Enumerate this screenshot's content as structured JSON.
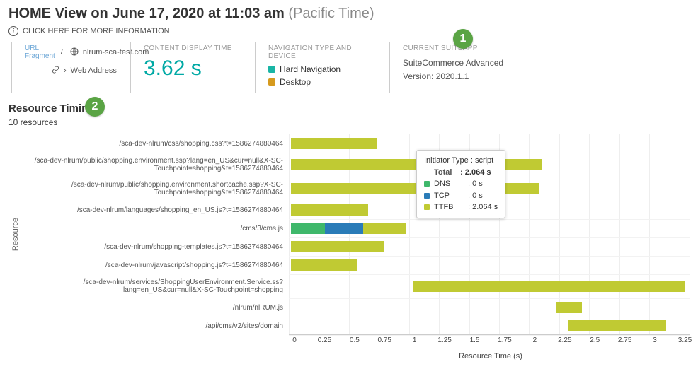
{
  "header": {
    "title_prefix": "HOME View on ",
    "date": "June 17, 2020",
    "at": " at ",
    "time": "11:03 am",
    "tz": " (Pacific Time)",
    "info_link": "CLICK HERE FOR MORE INFORMATION"
  },
  "badges": {
    "one": "1",
    "two": "2"
  },
  "url_panel": {
    "frag_label": "URL\nFragment",
    "domain": "nlrum-sca-test.com",
    "slash": "/",
    "web_address": "Web Address"
  },
  "cdt": {
    "label": "CONTENT DISPLAY TIME",
    "value": "3.62 s"
  },
  "nav": {
    "label": "NAVIGATION TYPE AND DEVICE",
    "hard": "Hard Navigation",
    "device": "Desktop"
  },
  "suite": {
    "label": "CURRENT SUITEAPP",
    "name": "SuiteCommerce Advanced",
    "version": "Version: 2020.1.1"
  },
  "section": {
    "title": "Resource Timing",
    "count": "10 resources"
  },
  "tooltip": {
    "init_label": "Initiator Type : ",
    "init_val": "script",
    "total_label": "Total",
    "total_val": ": 2.064 s",
    "dns_label": "DNS",
    "dns_val": ": 0 s",
    "tcp_label": "TCP",
    "tcp_val": ": 0 s",
    "ttfb_label": "TTFB",
    "ttfb_val": ": 2.064 s"
  },
  "chart_data": {
    "type": "bar",
    "xlabel": "Resource Time (s)",
    "ylabel": "Resource",
    "xlim": [
      0,
      3.3
    ],
    "xticks": [
      "0",
      "0.25",
      "0.5",
      "0.75",
      "1",
      "1.25",
      "1.5",
      "1.75",
      "2",
      "2.25",
      "2.5",
      "2.75",
      "3",
      "3.25"
    ],
    "resources": [
      {
        "name": "/sca-dev-nlrum/css/shopping.css?t=1586274880464",
        "start": 0.02,
        "end": 0.73
      },
      {
        "name": "/sca-dev-nlrum/public/shopping.environment.ssp?lang=en_US&cur=null&X-SC-Touchpoint=shopping&t=1586274880464",
        "start": 0.02,
        "end": 2.11
      },
      {
        "name": "/sca-dev-nlrum/public/shopping.environment.shortcache.ssp?X-SC-Touchpoint=shopping&t=1586274880464",
        "start": 0.02,
        "end": 2.08,
        "segments": {
          "dns": 0,
          "tcp": 0,
          "ttfb": 2.064
        }
      },
      {
        "name": "/sca-dev-nlrum/languages/shopping_en_US.js?t=1586274880464",
        "start": 0.02,
        "end": 0.66
      },
      {
        "name": "/cms/3/cms.js",
        "start": 0.02,
        "end": 0.96,
        "segments": {
          "dns": 0.28,
          "tcp": 0.32,
          "ttfb": 0.36,
          "colors": [
            "#3fb86b",
            "#2a7cb8",
            "#c0ca33"
          ]
        }
      },
      {
        "name": "/sca-dev-nlrum/shopping-templates.js?t=1586274880464",
        "start": 0.02,
        "end": 0.79
      },
      {
        "name": "/sca-dev-nlrum/javascript/shopping.js?t=1586274880464",
        "start": 0.02,
        "end": 0.57
      },
      {
        "name": "/sca-dev-nlrum/services/ShoppingUserEnvironment.Service.ss?lang=en_US&cur=null&X-SC-Touchpoint=shopping",
        "start": 1.04,
        "end": 3.3
      },
      {
        "name": "/nlrum/nlRUM.js",
        "start": 2.23,
        "end": 2.44
      },
      {
        "name": "/api/cms/v2/sites/domain",
        "start": 2.32,
        "end": 3.14
      }
    ]
  }
}
